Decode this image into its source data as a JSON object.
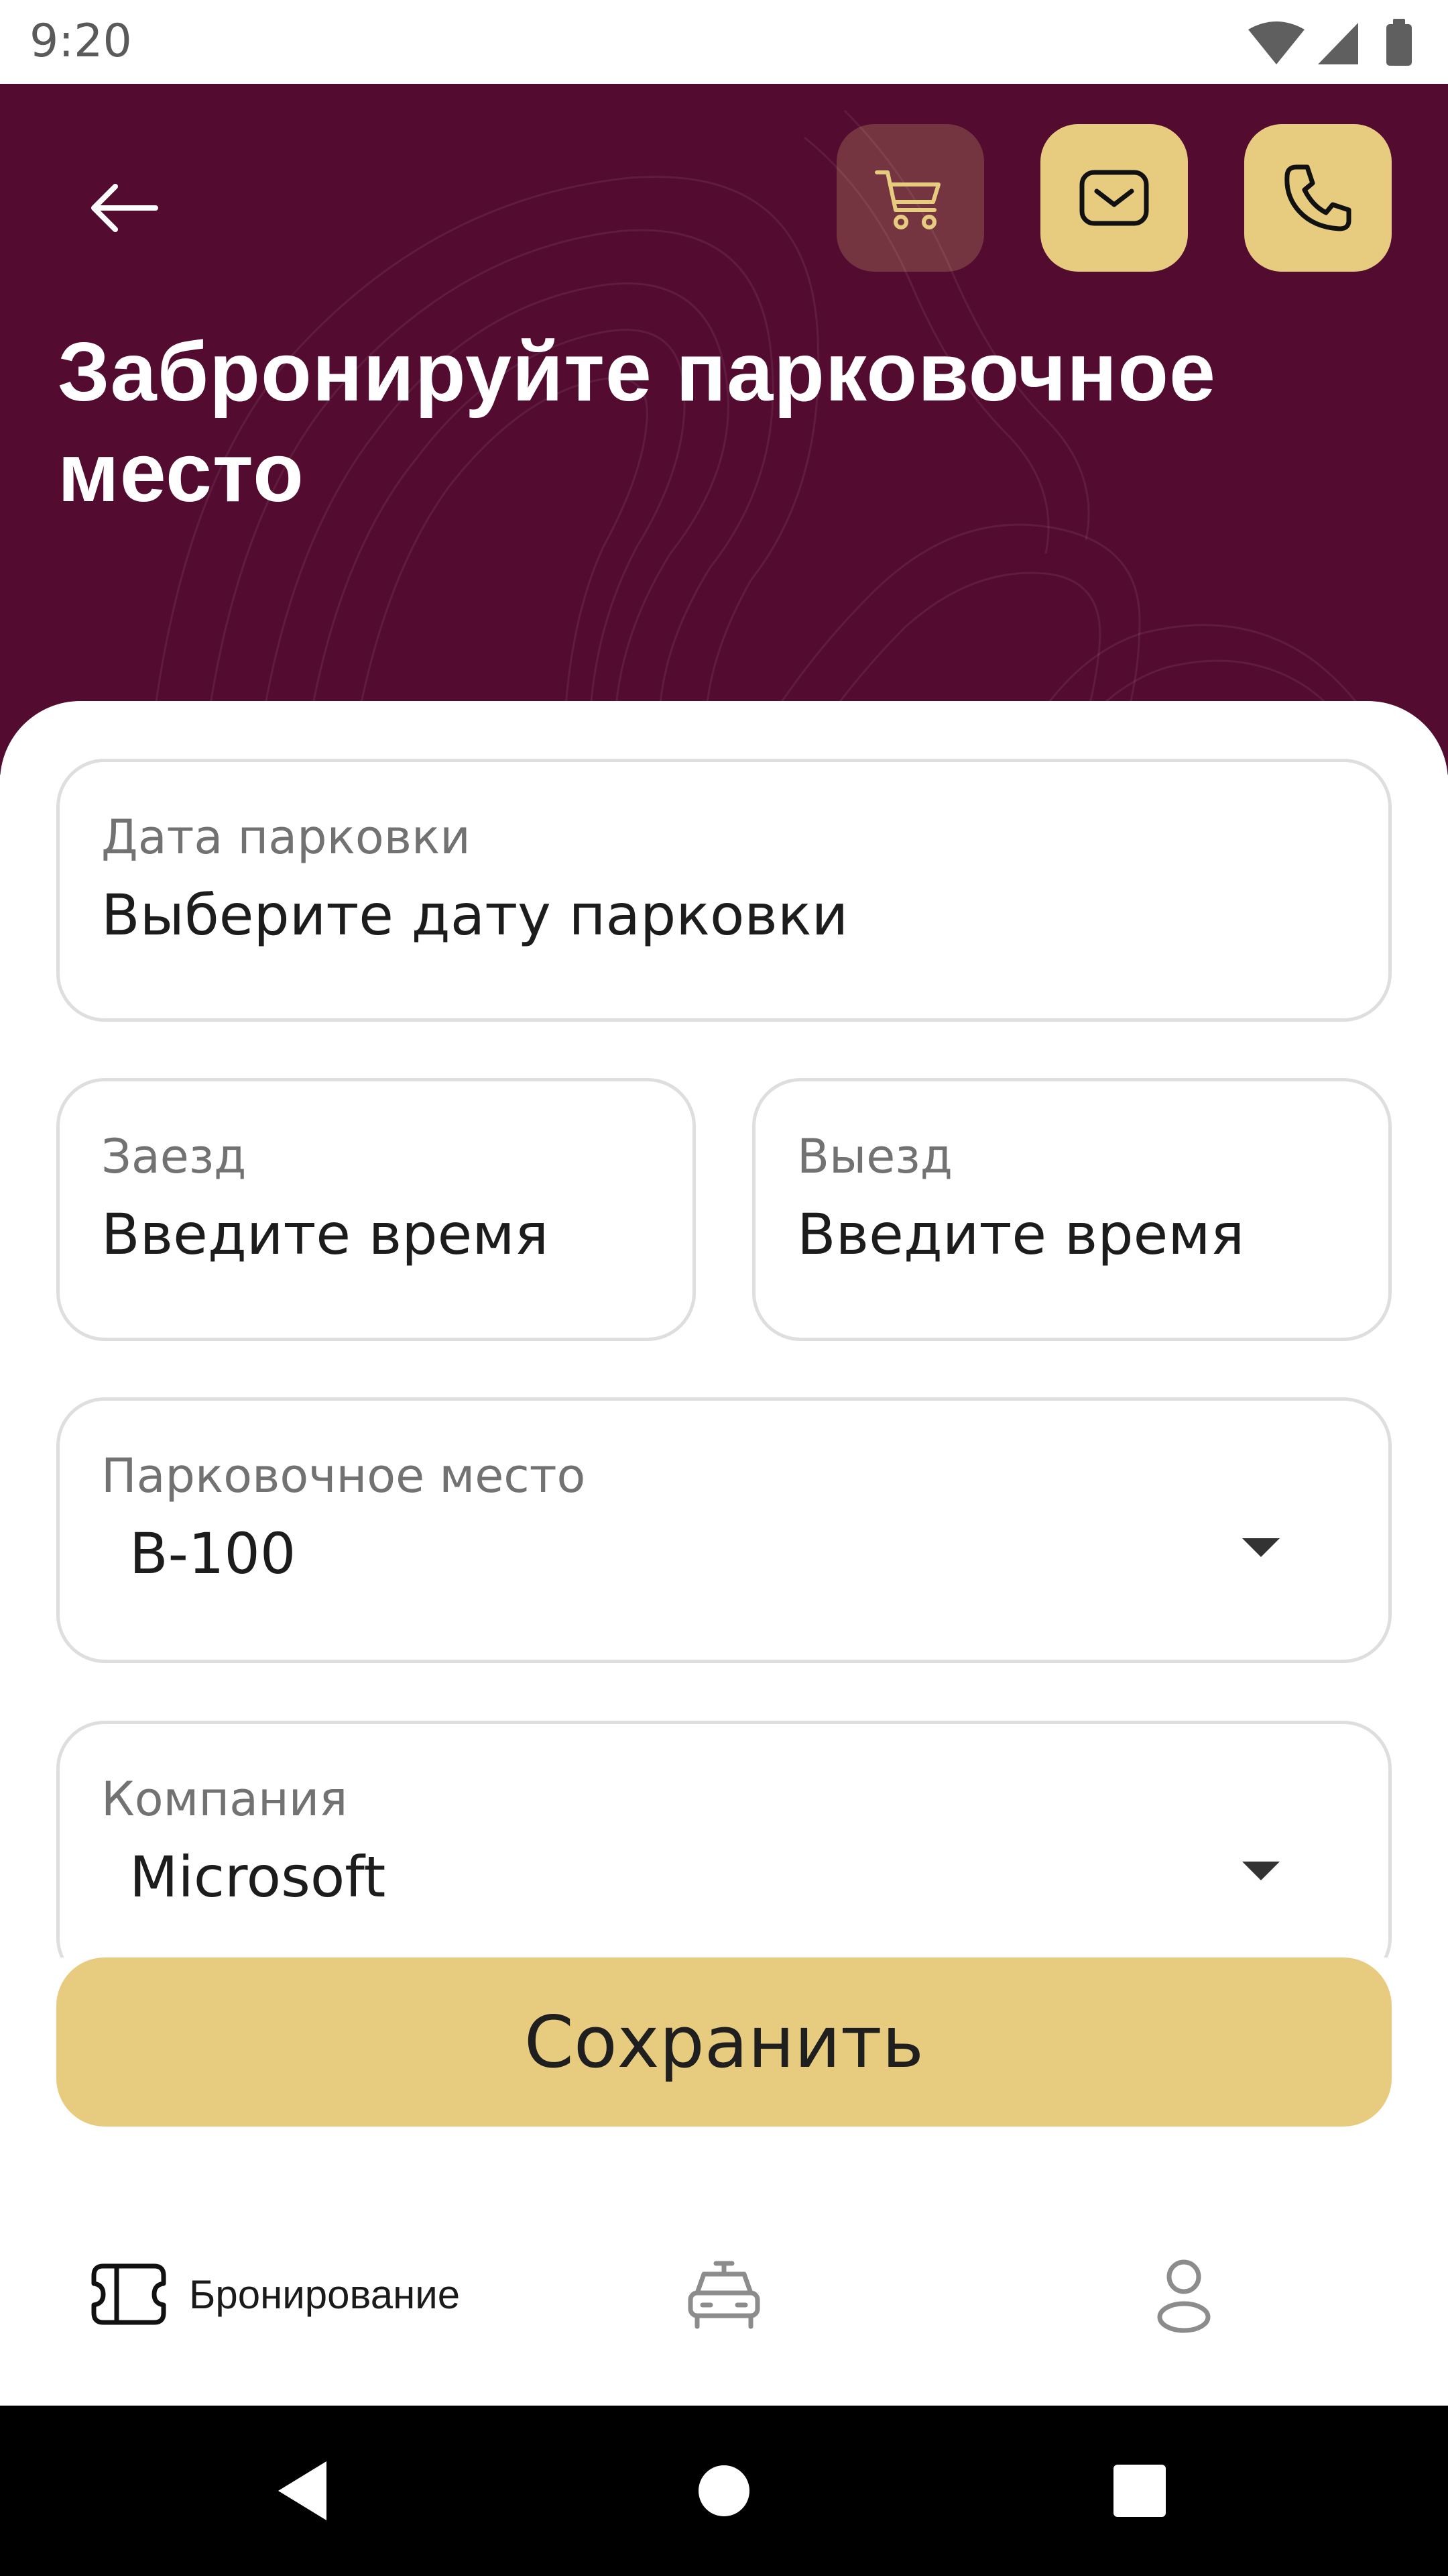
{
  "status_bar": {
    "time": "9:20",
    "icons": [
      "wifi-icon",
      "cellular-icon",
      "battery-icon"
    ]
  },
  "header": {
    "title": "Забронируйте парковочное место",
    "buttons": [
      "back-arrow-icon",
      "cart-icon",
      "mail-icon",
      "phone-icon"
    ],
    "background_color": "#540b30",
    "accent_color": "#e7cc80"
  },
  "form": {
    "parking_date": {
      "label": "Дата парковки",
      "placeholder": "Выберите дату парковки"
    },
    "check_in": {
      "label": "Заезд",
      "placeholder": "Введите время"
    },
    "check_out": {
      "label": "Выезд",
      "placeholder": "Введите время"
    },
    "parking_spot": {
      "label": "Парковочное место",
      "value": "B-100"
    },
    "company": {
      "label": "Компания",
      "value": "Microsoft"
    }
  },
  "save_button": {
    "label": "Сохранить"
  },
  "bottom_nav": {
    "items": [
      {
        "label": "Бронирование",
        "icon": "ticket-icon",
        "active": true
      },
      {
        "label": "",
        "icon": "car-icon",
        "active": false
      },
      {
        "label": "",
        "icon": "profile-icon",
        "active": false
      }
    ]
  },
  "system_nav": {
    "buttons": [
      "back-triangle-icon",
      "home-circle-icon",
      "recents-square-icon"
    ]
  }
}
